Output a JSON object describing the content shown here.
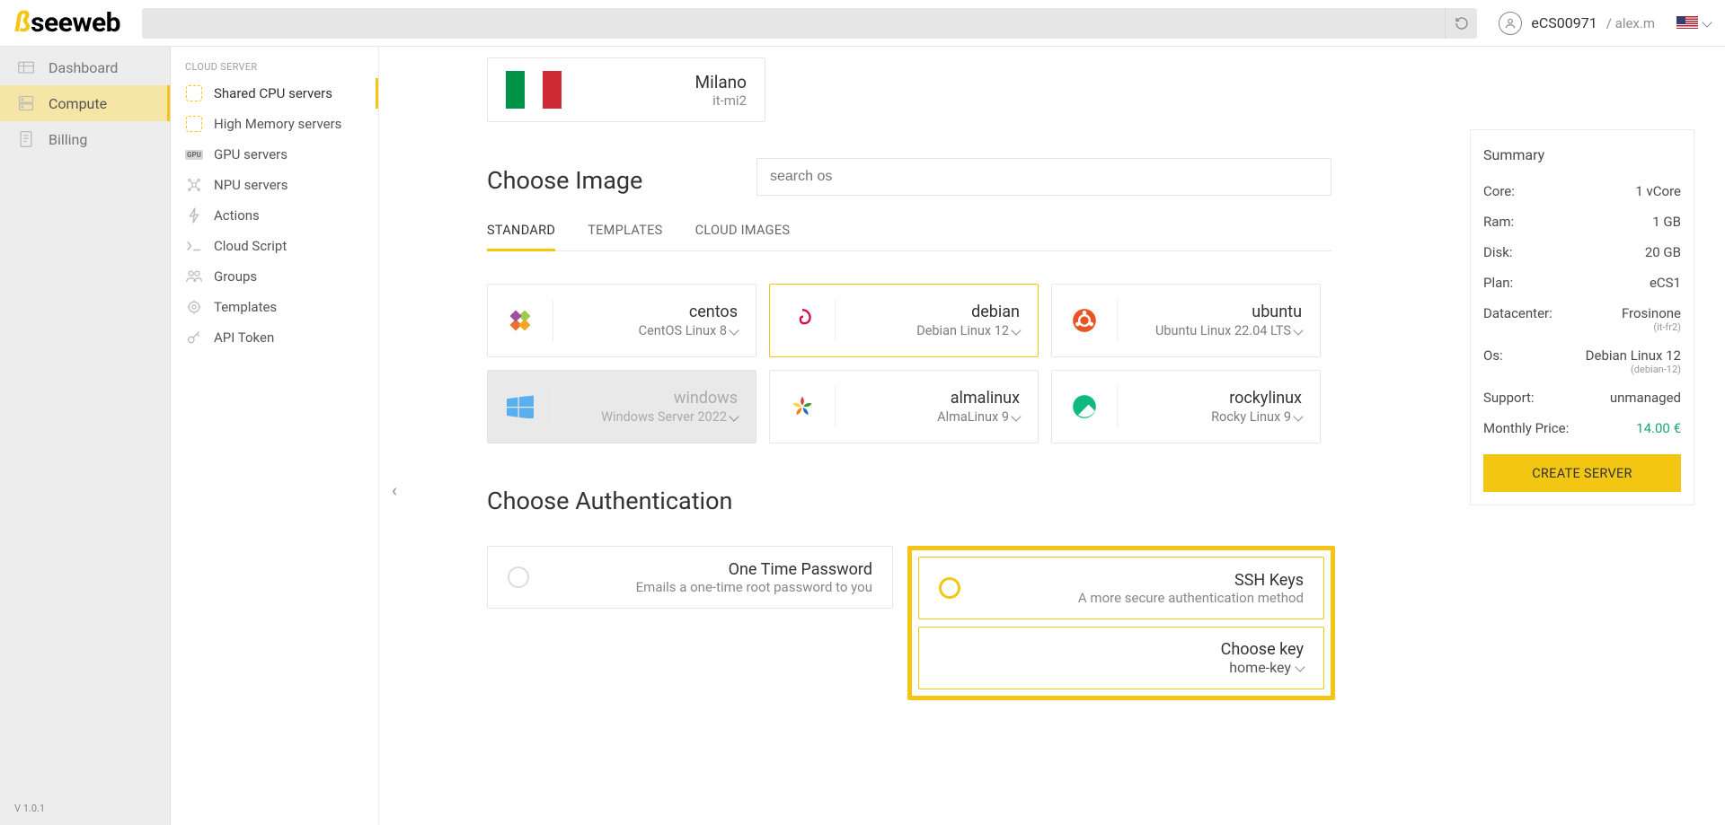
{
  "header": {
    "logo_prefix": "ß",
    "logo_text": "seeweb",
    "account_id": "eCS00971",
    "account_user": "/ alex.m"
  },
  "nav_primary": [
    {
      "label": "Dashboard"
    },
    {
      "label": "Compute"
    },
    {
      "label": "Billing"
    }
  ],
  "nav_secondary": {
    "header": "CLOUD SERVER",
    "items": [
      {
        "label": "Shared CPU servers"
      },
      {
        "label": "High Memory servers"
      },
      {
        "label": "GPU servers"
      },
      {
        "label": "NPU servers"
      },
      {
        "label": "Actions"
      },
      {
        "label": "Cloud Script"
      },
      {
        "label": "Groups"
      },
      {
        "label": "Templates"
      },
      {
        "label": "API Token"
      }
    ]
  },
  "version": "V 1.0.1",
  "location": {
    "city": "Milano",
    "code": "it-mi2"
  },
  "sections": {
    "choose_image": "Choose Image",
    "choose_auth": "Choose Authentication"
  },
  "search_os_placeholder": "search os",
  "tabs": {
    "standard": "STANDARD",
    "templates": "TEMPLATES",
    "cloud_images": "CLOUD IMAGES"
  },
  "os": [
    {
      "name": "centos",
      "ver": "CentOS Linux 8"
    },
    {
      "name": "debian",
      "ver": "Debian Linux 12"
    },
    {
      "name": "ubuntu",
      "ver": "Ubuntu Linux 22.04 LTS"
    },
    {
      "name": "windows",
      "ver": "Windows Server 2022"
    },
    {
      "name": "almalinux",
      "ver": "AlmaLinux 9"
    },
    {
      "name": "rockylinux",
      "ver": "Rocky Linux 9"
    }
  ],
  "auth": {
    "otp": {
      "title": "One Time Password",
      "sub": "Emails a one-time root password to you"
    },
    "ssh": {
      "title": "SSH Keys",
      "sub": "A more secure authentication method"
    },
    "key": {
      "title": "Choose key",
      "value": "home-key"
    }
  },
  "summary": {
    "title": "Summary",
    "rows": {
      "core": {
        "k": "Core:",
        "v": "1 vCore"
      },
      "ram": {
        "k": "Ram:",
        "v": "1 GB"
      },
      "disk": {
        "k": "Disk:",
        "v": "20 GB"
      },
      "plan": {
        "k": "Plan:",
        "v": "eCS1"
      },
      "dc": {
        "k": "Datacenter:",
        "v": "Frosinone",
        "n": "(it-fr2)"
      },
      "os": {
        "k": "Os:",
        "v": "Debian Linux 12",
        "n": "(debian-12)"
      },
      "support": {
        "k": "Support:",
        "v": "unmanaged"
      },
      "price": {
        "k": "Monthly Price:",
        "v": "14.00 €"
      }
    },
    "cta": "CREATE SERVER"
  }
}
